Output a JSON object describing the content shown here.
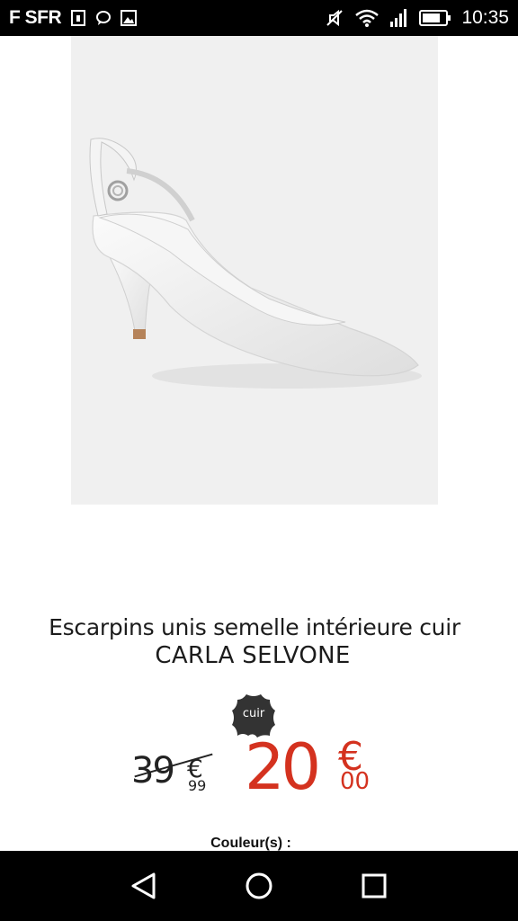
{
  "status_bar": {
    "carrier": "F SFR",
    "time": "10:35",
    "icons": [
      "sim-icon",
      "chat-bubble-icon",
      "gallery-icon",
      "mute-icon",
      "wifi-icon",
      "signal-icon",
      "battery-icon"
    ]
  },
  "product": {
    "image": "white-slingback-pump",
    "title": "Escarpins unis semelle intérieure cuir",
    "brand": "CARLA SELVONE",
    "badge": "cuir",
    "old_price": {
      "integer": "39",
      "currency": "€",
      "cents": "99"
    },
    "new_price": {
      "integer": "20",
      "currency": "€",
      "cents": "00"
    },
    "colors_label": "Couleur(s) :"
  },
  "colors": {
    "status_bar_bg": "#000000",
    "image_bg": "#f0f0f0",
    "price_red": "#d4321f",
    "badge_dark": "#333333"
  },
  "nav_bar": {
    "buttons": [
      "back-icon",
      "home-icon",
      "recents-icon"
    ]
  }
}
